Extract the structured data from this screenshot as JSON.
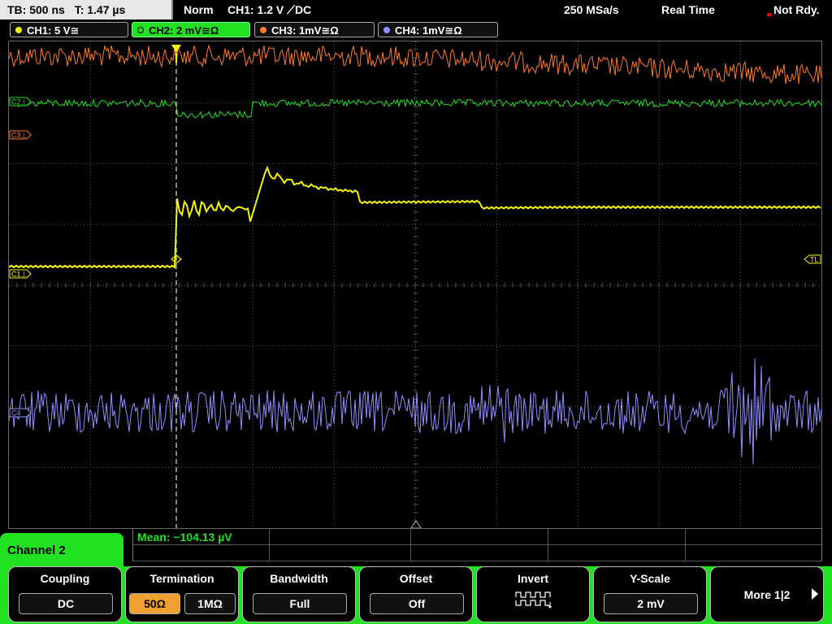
{
  "topbar": {
    "timebase": "TB: 500 ns",
    "trigger_time": "T: 1.47 µs",
    "mode": "Norm",
    "trigger_info": "CH1: 1.2 V ⟋DC",
    "sample_rate": "250 MSa/s",
    "acq_mode": "Real Time",
    "status": "Not Rdy."
  },
  "channels": [
    {
      "label": "CH1: 5 V≅",
      "color": "#f5f500"
    },
    {
      "label": "CH2: 2 mV≅Ω",
      "color": "#22e022"
    },
    {
      "label": "CH3: 1mV≅Ω",
      "color": "#ff7a2a"
    },
    {
      "label": "CH4: 1mV≅Ω",
      "color": "#8f8fff"
    }
  ],
  "markers": {
    "ch2": "C2⊥",
    "ch3": "C3⊥",
    "ch1": "C1⊥",
    "ch4": "C4",
    "trigger_level": "TL"
  },
  "measurement": {
    "mean": "Mean: −104.13 µV"
  },
  "active_channel": "Channel 2",
  "menu": {
    "coupling": {
      "label": "Coupling",
      "value": "DC"
    },
    "termination": {
      "label": "Termination",
      "opt1": "50Ω",
      "opt2": "1MΩ",
      "selected": "50Ω"
    },
    "bandwidth": {
      "label": "Bandwidth",
      "value": "Full"
    },
    "offset": {
      "label": "Offset",
      "value": "Off"
    },
    "invert": {
      "label": "Invert"
    },
    "yscale": {
      "label": "Y-Scale",
      "value": "2 mV"
    },
    "more": {
      "label": "More 1|2"
    }
  },
  "colors": {
    "ch1": "#f5f500",
    "ch2": "#22e022",
    "ch3": "#ff7a2a",
    "ch4": "#8f8fff",
    "grid": "#555555",
    "accent": "#22e022",
    "termination_selected": "#f0a030"
  }
}
